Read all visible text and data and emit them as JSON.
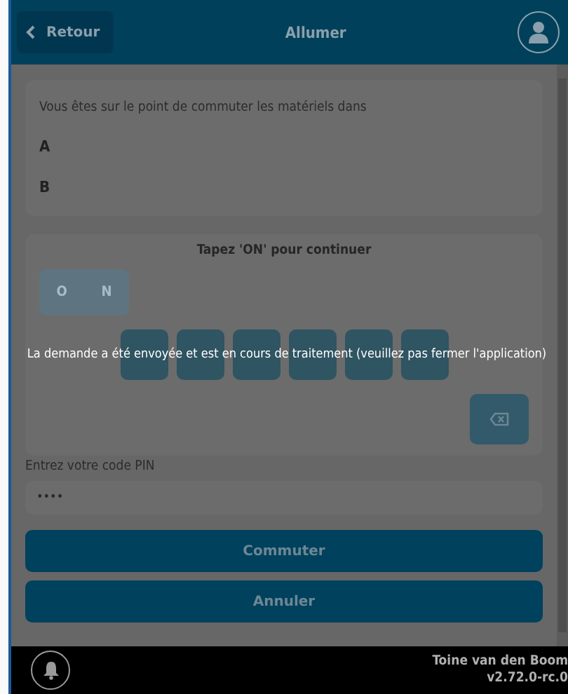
{
  "header": {
    "back_label": "Retour",
    "title": "Allumer"
  },
  "info": {
    "text": "Vous êtes sur le point de commuter les matériels dans",
    "items": [
      "A",
      "B"
    ]
  },
  "challenge": {
    "prompt": "Tapez 'ON' pour continuer",
    "typed": [
      "O",
      "N"
    ],
    "keys": [
      {
        "kind": "letter"
      },
      {
        "kind": "letter"
      },
      {
        "kind": "letter"
      },
      {
        "kind": "letter"
      },
      {
        "kind": "letter"
      },
      {
        "kind": "letter"
      }
    ]
  },
  "pin": {
    "label": "Entrez votre code PIN",
    "value": "••••"
  },
  "buttons": [
    "Commuter",
    "Annuler"
  ],
  "message": "La demande a été envoyée et est en cours de traitement (veuillez pas fermer l'application)",
  "footer": {
    "user": "Toine van den Boom",
    "version": "v2.72.0-rc.0"
  }
}
